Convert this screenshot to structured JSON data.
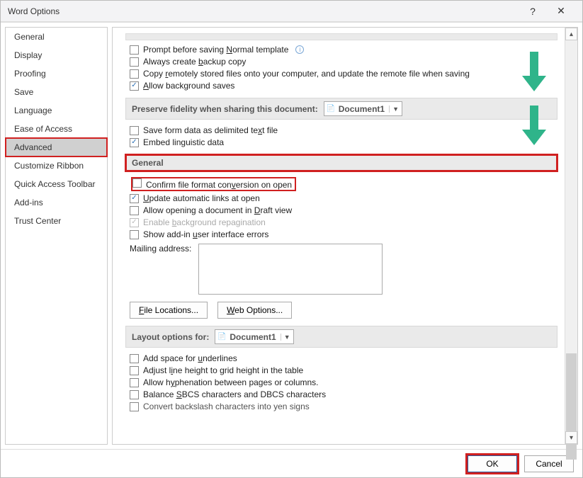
{
  "title": "Word Options",
  "sidebar": {
    "items": [
      {
        "label": "General"
      },
      {
        "label": "Display"
      },
      {
        "label": "Proofing"
      },
      {
        "label": "Save"
      },
      {
        "label": "Language"
      },
      {
        "label": "Ease of Access"
      },
      {
        "label": "Advanced"
      },
      {
        "label": "Customize Ribbon"
      },
      {
        "label": "Quick Access Toolbar"
      },
      {
        "label": "Add-ins"
      },
      {
        "label": "Trust Center"
      }
    ],
    "selected_index": 6
  },
  "save_section": {
    "opts": [
      {
        "key": "prompt_normal",
        "html": "Prompt before saving <u>N</u>ormal template",
        "checked": false,
        "info": true
      },
      {
        "key": "backup_copy",
        "html": "Always create <u>b</u>ackup copy",
        "checked": false
      },
      {
        "key": "copy_remote",
        "html": "Copy <u>r</u>emotely stored files onto your computer, and update the remote file when saving",
        "checked": false
      },
      {
        "key": "bg_saves",
        "html": "<u>A</u>llow background saves",
        "checked": true
      }
    ]
  },
  "fidelity": {
    "header": "Preserve fidelity when sharing this document:",
    "doc_label": "Document1",
    "opts": [
      {
        "key": "save_form_data",
        "html": "Save form data as delimited te<u>x</u>t file",
        "checked": false
      },
      {
        "key": "embed_ling",
        "html": "Embed lin<u>g</u>uistic data",
        "checked": true
      }
    ]
  },
  "general": {
    "header": "General",
    "opts": [
      {
        "key": "confirm_conv",
        "html": "Confirm file format con<u>v</u>ersion on open",
        "checked": false,
        "highlight": true
      },
      {
        "key": "auto_links",
        "html": "<u>U</u>pdate automatic links at open",
        "checked": true
      },
      {
        "key": "draft_open",
        "html": "Allow opening a document in <u>D</u>raft view",
        "checked": false
      },
      {
        "key": "bg_repag",
        "html": "Enable <u>b</u>ackground repagination",
        "checked": true,
        "disabled": true
      },
      {
        "key": "addin_errors",
        "html": "Show add-in <u>u</u>ser interface errors",
        "checked": false
      }
    ],
    "mailing_label": "Mailing address:",
    "file_locations_btn": "File Locations...",
    "web_options_btn": "Web Options..."
  },
  "layout": {
    "header": "Layout options for:",
    "doc_label": "Document1",
    "opts": [
      {
        "key": "space_underlines",
        "html": "Add space for <u>u</u>nderlines",
        "checked": false
      },
      {
        "key": "adjust_line",
        "html": "Adjust l<u>i</u>ne height to grid height in the table",
        "checked": false
      },
      {
        "key": "allow_hyphen",
        "html": "Allow h<u>y</u>phenation between pages or columns.",
        "checked": false
      },
      {
        "key": "balance_sbcs",
        "html": "Balance <u>S</u>BCS characters and DBCS characters",
        "checked": false
      },
      {
        "key": "convert_backslash",
        "html": "Convert backslash characters into yen signs",
        "checked": false,
        "cutoff": true
      }
    ]
  },
  "footer": {
    "ok": "OK",
    "cancel": "Cancel"
  }
}
